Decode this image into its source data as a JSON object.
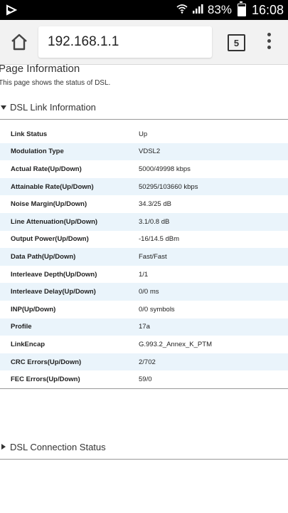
{
  "status_bar": {
    "battery_percent": "83%",
    "time": "16:08",
    "battery_level": 0.83
  },
  "browser": {
    "url": "192.168.1.1",
    "tab_count": "5"
  },
  "page": {
    "title": "Page Information",
    "description": "This page shows the status of DSL."
  },
  "sections": {
    "link_info_label": "DSL Link Information",
    "connection_status_label": "DSL Connection Status"
  },
  "link_info": [
    {
      "label": "Link Status",
      "value": "Up"
    },
    {
      "label": "Modulation Type",
      "value": "VDSL2"
    },
    {
      "label": "Actual Rate(Up/Down)",
      "value": "5000/49998 kbps"
    },
    {
      "label": "Attainable Rate(Up/Down)",
      "value": "50295/103660 kbps"
    },
    {
      "label": "Noise Margin(Up/Down)",
      "value": "34.3/25 dB"
    },
    {
      "label": "Line Attenuation(Up/Down)",
      "value": "3.1/0.8 dB"
    },
    {
      "label": "Output Power(Up/Down)",
      "value": "-16/14.5 dBm"
    },
    {
      "label": "Data Path(Up/Down)",
      "value": "Fast/Fast"
    },
    {
      "label": "Interleave Depth(Up/Down)",
      "value": "1/1"
    },
    {
      "label": "Interleave Delay(Up/Down)",
      "value": "0/0 ms"
    },
    {
      "label": "INP(Up/Down)",
      "value": "0/0 symbols"
    },
    {
      "label": "Profile",
      "value": "17a"
    },
    {
      "label": "LinkEncap",
      "value": "G.993.2_Annex_K_PTM"
    },
    {
      "label": "CRC Errors(Up/Down)",
      "value": "2/702"
    },
    {
      "label": "FEC Errors(Up/Down)",
      "value": "59/0"
    }
  ]
}
